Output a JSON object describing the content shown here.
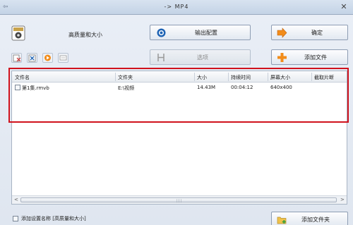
{
  "window": {
    "title": "-> MP4",
    "close_glyph": "✕",
    "app_icon": "back-arrow-icon"
  },
  "preset": {
    "label": "高质量和大小",
    "icon": "video-settings-icon"
  },
  "buttons": {
    "output_config": "输出配置",
    "ok": "确定",
    "options": "选项",
    "add_file": "添加文件",
    "add_folder": "添加文件夹"
  },
  "toolbar_icons": [
    "file-remove-icon",
    "clear-icon",
    "play-icon",
    "info-icon"
  ],
  "list": {
    "columns": [
      "文件名",
      "文件夹",
      "大小",
      "持续时间",
      "屏幕大小",
      "截取片断"
    ],
    "rows": [
      {
        "name": "第1集.rmvb",
        "folder": "E:\\视频",
        "size": "14.43M",
        "duration": "00:04:12",
        "screen": "640x400"
      }
    ],
    "scroll": {
      "left": "<",
      "right": ">",
      "grip": "|||"
    }
  },
  "footer": {
    "add_setting_name": "添加设置名称 [高质量和大小]"
  },
  "colors": {
    "highlight": "#d0121d",
    "accent_orange": "#f28c1a"
  }
}
